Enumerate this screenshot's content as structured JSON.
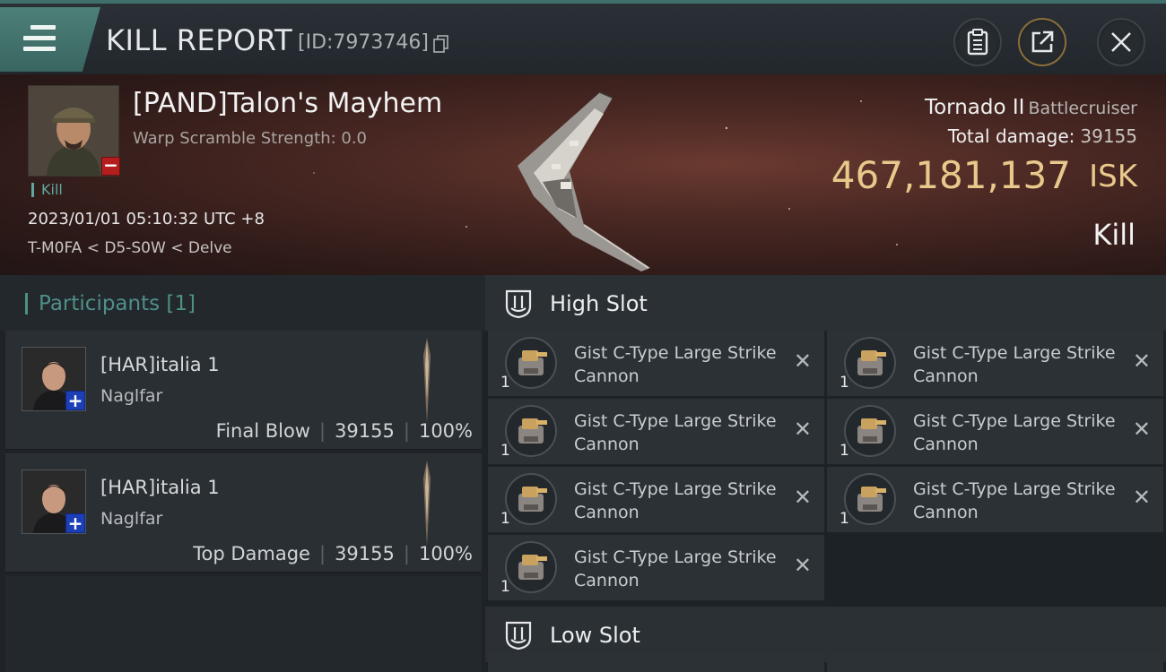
{
  "header": {
    "title": "KILL REPORT",
    "id_text": "[ID:7973746]"
  },
  "victim": {
    "name": "[PAND]Talon's Mayhem",
    "scramble": "Warp Scramble Strength: 0.0",
    "tag": "Kill",
    "time": "2023/01/01 05:10:32 UTC +8",
    "location": "T-M0FA < D5-S0W < Delve",
    "ship": "Tornado II",
    "ship_class": "Battlecruiser",
    "total_damage_label": "Total damage:",
    "total_damage": "39155",
    "isk_value": "467,181,137",
    "isk_unit": "ISK",
    "result": "Kill"
  },
  "participants": {
    "title": "Participants [1]",
    "rows": [
      {
        "name": "[HAR]italia 1",
        "ship": "Naglfar",
        "role": "Final Blow",
        "damage": "39155",
        "percent": "100%"
      },
      {
        "name": "[HAR]italia 1",
        "ship": "Naglfar",
        "role": "Top Damage",
        "damage": "39155",
        "percent": "100%"
      }
    ]
  },
  "high_slot": {
    "title": "High Slot",
    "modules": [
      {
        "name": "Gist C-Type Large Strike Cannon",
        "qty": "1"
      },
      {
        "name": "Gist C-Type Large Strike Cannon",
        "qty": "1"
      },
      {
        "name": "Gist C-Type Large Strike Cannon",
        "qty": "1"
      },
      {
        "name": "Gist C-Type Large Strike Cannon",
        "qty": "1"
      },
      {
        "name": "Gist C-Type Large Strike Cannon",
        "qty": "1"
      },
      {
        "name": "Gist C-Type Large Strike Cannon",
        "qty": "1"
      },
      {
        "name": "Gist C-Type Large Strike Cannon",
        "qty": "1"
      }
    ]
  },
  "low_slot": {
    "title": "Low Slot"
  },
  "icons": {
    "menu": "hamburger-icon",
    "copy": "copy-icon",
    "clipboard": "clipboard-icon",
    "share": "share-icon",
    "close": "close-icon",
    "slot": "slot-icon",
    "remove": "x-icon"
  },
  "colors": {
    "accent": "#4f8f88",
    "isk": "#e9c98b",
    "banner": "#4a2823"
  }
}
